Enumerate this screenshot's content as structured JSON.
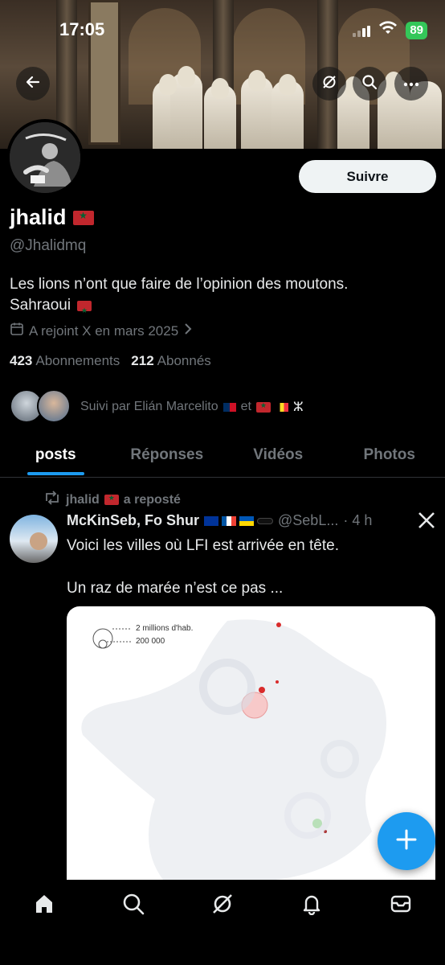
{
  "status_bar": {
    "time": "17:05",
    "battery": "89"
  },
  "profile": {
    "name": "jhalid",
    "handle": "@Jhalidmq",
    "follow_label": "Suivre",
    "bio_line1": "Les lions n’ont que faire de l’opinion des moutons.",
    "bio_line2": "Sahraoui",
    "joined": "A rejoint X en mars 2025",
    "following_count": "423",
    "following_label": "Abonnements",
    "followers_count": "212",
    "followers_label": "Abonnés",
    "followed_by_prefix": "Suivi par Elián Marcelito",
    "followed_by_and": "et",
    "followed_by_symbol": "ⵣ"
  },
  "tabs": [
    {
      "label": "posts",
      "active": true
    },
    {
      "label": "Réponses",
      "active": false
    },
    {
      "label": "Vidéos",
      "active": false
    },
    {
      "label": "Photos",
      "active": false
    }
  ],
  "post": {
    "repost_by": "jhalid",
    "repost_suffix": "a reposté",
    "author_name": "McKinSeb, Fo Shur",
    "author_handle": "@SebL...",
    "time": "· 4 h",
    "text1": "Voici les villes où LFI est arrivée en tête.",
    "text2": "Un raz de marée n’est ce pas ...",
    "map_legend": [
      "2 millions d'hab.",
      "200 000"
    ]
  },
  "icons": {
    "back": "back-arrow-icon",
    "grok": "grok-icon",
    "search": "search-icon",
    "more": "more-icon",
    "calendar": "calendar-icon",
    "chevron": "chevron-right-icon",
    "repost": "repost-icon",
    "x_logo": "x-logo-icon",
    "compose": "plus-icon",
    "home": "home-icon",
    "notifications": "bell-icon",
    "messages": "mail-icon"
  },
  "colors": {
    "accent": "#1d9bf0",
    "morocco_red": "#c1272d",
    "battery_green": "#34c759"
  }
}
